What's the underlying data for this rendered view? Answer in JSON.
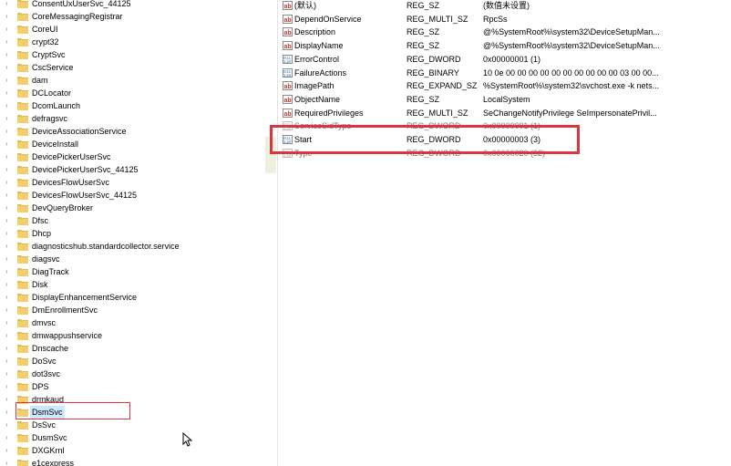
{
  "tree": {
    "items": [
      {
        "label": "ConsentUxUserSvc_44125"
      },
      {
        "label": "CoreMessagingRegistrar"
      },
      {
        "label": "CoreUI"
      },
      {
        "label": "crypt32"
      },
      {
        "label": "CryptSvc"
      },
      {
        "label": "CscService"
      },
      {
        "label": "dam"
      },
      {
        "label": "DCLocator"
      },
      {
        "label": "DcomLaunch"
      },
      {
        "label": "defragsvc"
      },
      {
        "label": "DeviceAssociationService"
      },
      {
        "label": "DeviceInstall"
      },
      {
        "label": "DevicePickerUserSvc"
      },
      {
        "label": "DevicePickerUserSvc_44125"
      },
      {
        "label": "DevicesFlowUserSvc"
      },
      {
        "label": "DevicesFlowUserSvc_44125"
      },
      {
        "label": "DevQueryBroker"
      },
      {
        "label": "Dfsc"
      },
      {
        "label": "Dhcp"
      },
      {
        "label": "diagnosticshub.standardcollector.service"
      },
      {
        "label": "diagsvc"
      },
      {
        "label": "DiagTrack"
      },
      {
        "label": "Disk"
      },
      {
        "label": "DisplayEnhancementService"
      },
      {
        "label": "DmEnrollmentSvc"
      },
      {
        "label": "dmvsc"
      },
      {
        "label": "dmwappushservice"
      },
      {
        "label": "Dnscache"
      },
      {
        "label": "DoSvc"
      },
      {
        "label": "dot3svc"
      },
      {
        "label": "DPS"
      },
      {
        "label": "drmkaud"
      },
      {
        "label": "DsmSvc"
      },
      {
        "label": "DsSvc"
      },
      {
        "label": "DusmSvc"
      },
      {
        "label": "DXGKrnl"
      },
      {
        "label": "e1cexpress"
      }
    ],
    "selected_index": 32
  },
  "values": {
    "rows": [
      {
        "name": "(默认)",
        "type": "REG_SZ",
        "data": "(数值未设置)",
        "icon": "string-value-icon"
      },
      {
        "name": "DependOnService",
        "type": "REG_MULTI_SZ",
        "data": "RpcSs",
        "icon": "string-value-icon"
      },
      {
        "name": "Description",
        "type": "REG_SZ",
        "data": "@%SystemRoot%\\system32\\DeviceSetupMan...",
        "icon": "string-value-icon"
      },
      {
        "name": "DisplayName",
        "type": "REG_SZ",
        "data": "@%SystemRoot%\\system32\\DeviceSetupMan...",
        "icon": "string-value-icon"
      },
      {
        "name": "ErrorControl",
        "type": "REG_DWORD",
        "data": "0x00000001 (1)",
        "icon": "binary-value-icon"
      },
      {
        "name": "FailureActions",
        "type": "REG_BINARY",
        "data": "10 0e 00 00 00 00 00 00 00 00 00 00 03 00 00...",
        "icon": "binary-value-icon"
      },
      {
        "name": "ImagePath",
        "type": "REG_EXPAND_SZ",
        "data": "%SystemRoot%\\system32\\svchost.exe -k nets...",
        "icon": "string-value-icon"
      },
      {
        "name": "ObjectName",
        "type": "REG_SZ",
        "data": "LocalSystem",
        "icon": "string-value-icon"
      },
      {
        "name": "RequiredPrivileges",
        "type": "REG_MULTI_SZ",
        "data": "SeChangeNotifyPrivilege SeImpersonatePrivil...",
        "icon": "string-value-icon"
      },
      {
        "name": "ServiceSidType",
        "type": "REG_DWORD",
        "data": "0x00000001 (1)",
        "icon": "binary-value-icon"
      },
      {
        "name": "Start",
        "type": "REG_DWORD",
        "data": "0x00000003 (3)",
        "icon": "binary-value-icon"
      },
      {
        "name": "Type",
        "type": "REG_DWORD",
        "data": "0x00000020 (32)",
        "icon": "binary-value-icon"
      }
    ]
  },
  "colors": {
    "highlight": "#d9373d",
    "selection": "#cce8ff",
    "folder": "#e8b84a"
  }
}
